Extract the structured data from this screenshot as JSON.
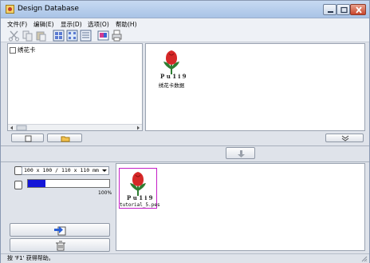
{
  "window": {
    "title": "Design Database"
  },
  "menu": [
    "文件(F)",
    "编辑(E)",
    "显示(D)",
    "选项(O)",
    "帮助(H)"
  ],
  "toolbar": {
    "icons": [
      "cut-icon",
      "copy-icon",
      "paste-icon",
      "large-icons-view-icon",
      "small-icons-view-icon",
      "list-view-icon",
      "properties-icon",
      "print-icon"
    ]
  },
  "tree": {
    "items": [
      {
        "label": "绣花卡"
      }
    ]
  },
  "thumbnails": [
    {
      "label": "绣花卡数据"
    }
  ],
  "output": {
    "size_option": "100 x 100 / 110 x 110 mm",
    "progress_percent": 100,
    "progress_label": "100%",
    "files": [
      {
        "label": "tutorial_5.pes"
      }
    ]
  },
  "status": {
    "text": "按 'F1' 获得帮助。"
  }
}
